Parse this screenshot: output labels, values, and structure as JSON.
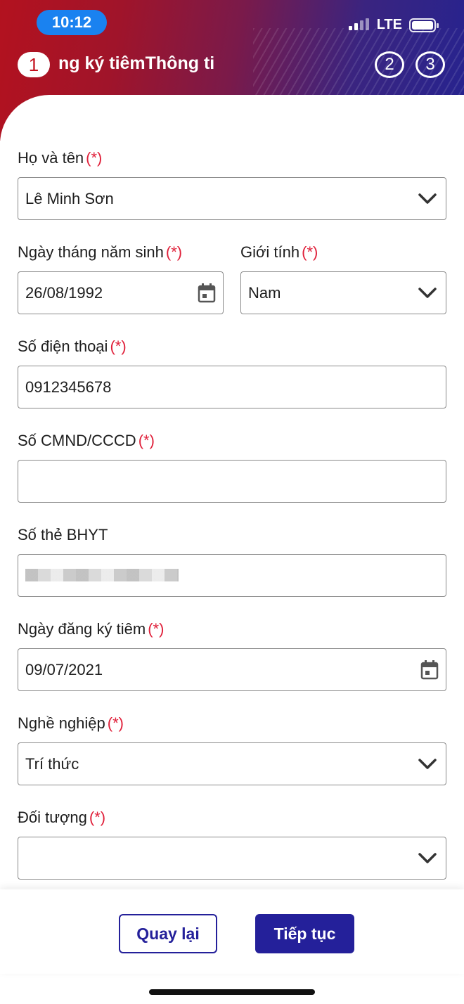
{
  "status_bar": {
    "time": "10:12",
    "network": "LTE"
  },
  "stepper": {
    "active_step": "1",
    "title": "ng ký tiêmThông ti",
    "steps": [
      "2",
      "3"
    ]
  },
  "form": {
    "required_mark": "(*)",
    "full_name": {
      "label": "Họ và tên",
      "value": "Lê Minh Sơn"
    },
    "dob": {
      "label": "Ngày tháng năm sinh",
      "value": "26/08/1992"
    },
    "gender": {
      "label": "Giới tính",
      "value": "Nam"
    },
    "phone": {
      "label": "Số điện thoại",
      "value": "0912345678"
    },
    "id_card": {
      "label": "Số CMND/CCCD",
      "value": ""
    },
    "insurance": {
      "label": "Số thẻ BHYT"
    },
    "reg_date": {
      "label": "Ngày đăng ký tiêm",
      "value": "09/07/2021"
    },
    "occupation": {
      "label": "Nghề nghiệp",
      "value": "Trí thức"
    },
    "group": {
      "label": "Đối tượng",
      "value": ""
    }
  },
  "actions": {
    "back": "Quay lại",
    "next": "Tiếp tục"
  },
  "colors": {
    "primary": "#24209a",
    "required": "#e0203a",
    "header_start": "#b3121f",
    "header_end": "#26238f"
  }
}
